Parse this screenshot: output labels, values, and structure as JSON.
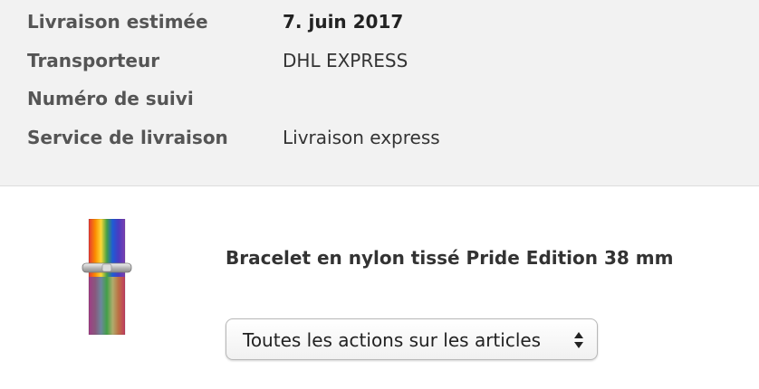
{
  "shipping": {
    "rows": [
      {
        "label": "Livraison estimée",
        "value": "7. juin 2017"
      },
      {
        "label": "Transporteur",
        "value": "DHL EXPRESS"
      },
      {
        "label": "Numéro de suivi",
        "value": ""
      },
      {
        "label": "Service de livraison",
        "value": "Livraison express"
      }
    ]
  },
  "product": {
    "name": "Bracelet en nylon tissé Pride Edition 38 mm",
    "image_icon": "rainbow-nylon-watch-band"
  },
  "actions": {
    "selected_label": "Toutes les actions sur les articles",
    "icon": "up-down-chevron-icon"
  },
  "colors": {
    "panel_background": "#f2f2f2",
    "label_text": "#555555",
    "value_text": "#333333"
  }
}
